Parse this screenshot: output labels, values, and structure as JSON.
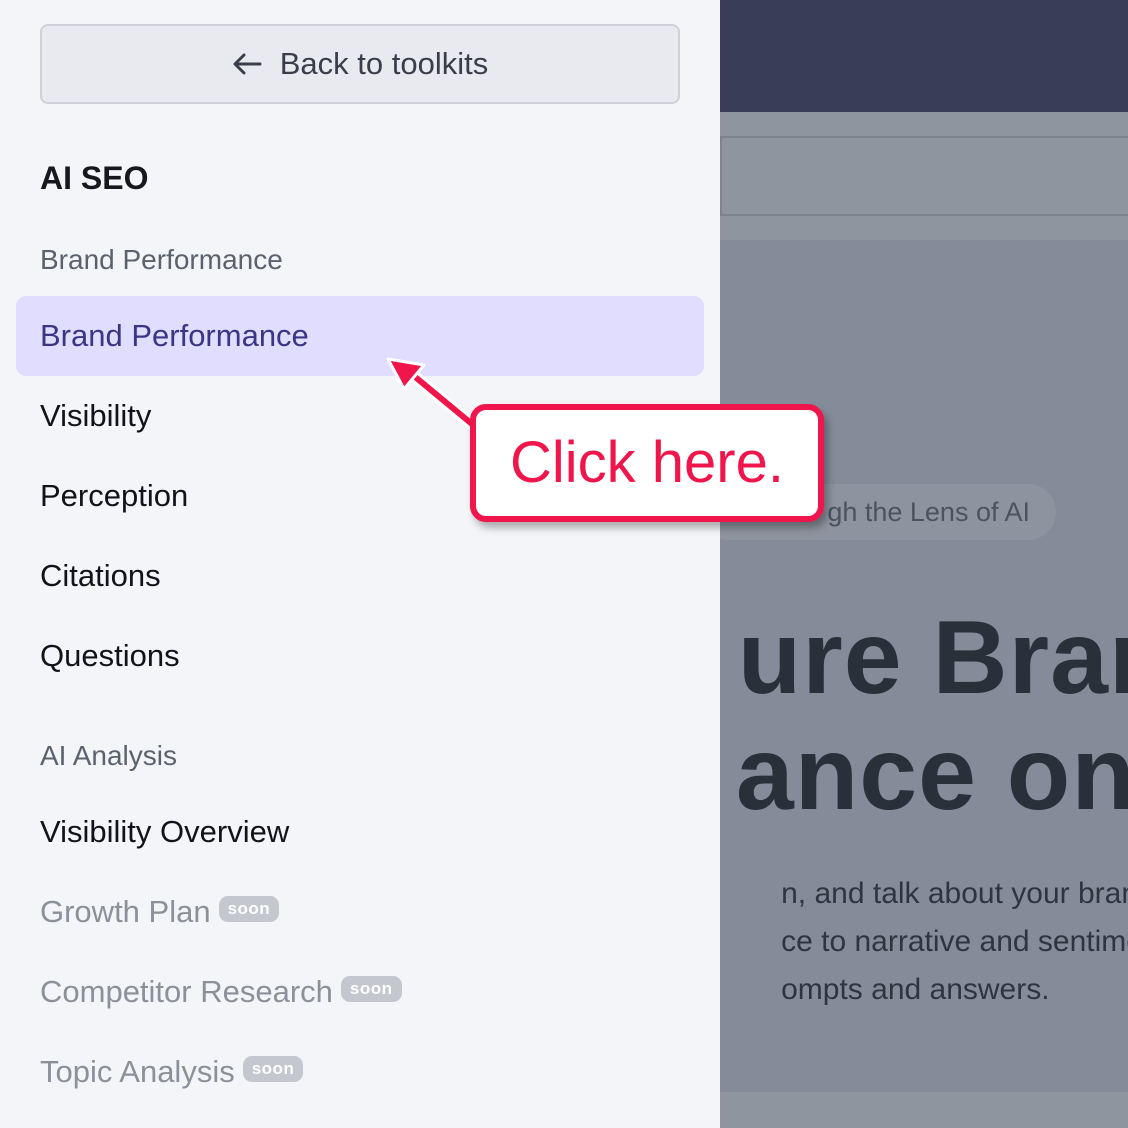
{
  "sidebar": {
    "back_button": {
      "label": "Back to toolkits",
      "icon": "arrow-left-icon"
    },
    "title": "AI SEO",
    "groups": [
      {
        "label": "Brand Performance",
        "items": [
          {
            "label": "Brand Performance",
            "active": true
          },
          {
            "label": "Visibility"
          },
          {
            "label": "Perception"
          },
          {
            "label": "Citations"
          },
          {
            "label": "Questions"
          }
        ]
      },
      {
        "label": "AI Analysis",
        "items": [
          {
            "label": "Visibility Overview"
          },
          {
            "label": "Growth Plan",
            "badge": "soon",
            "disabled": true
          },
          {
            "label": "Competitor Research",
            "badge": "soon",
            "disabled": true
          },
          {
            "label": "Topic Analysis",
            "badge": "soon",
            "disabled": true
          }
        ]
      }
    ]
  },
  "background": {
    "pill_text": "gh the Lens of AI",
    "heading_lines": [
      "ure Brand",
      "ance on A"
    ],
    "description_lines": [
      "n, and talk about your brand",
      "ce to narrative and sentiment",
      "ompts and answers."
    ]
  },
  "annotation": {
    "text": "Click here.",
    "color": "#f0154b"
  },
  "colors": {
    "active_bg": "#e0ddfe",
    "active_text": "#3b3584",
    "topbar": "#393d58"
  }
}
